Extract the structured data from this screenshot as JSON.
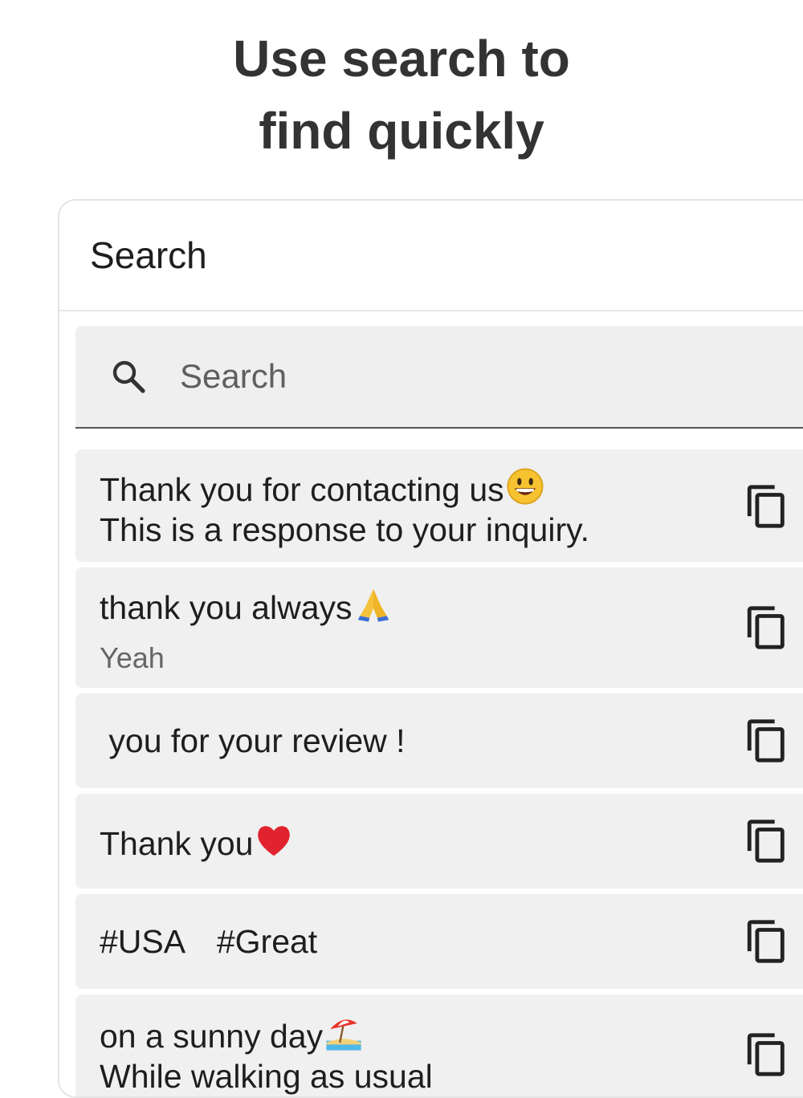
{
  "promo": {
    "line1": "Use search to",
    "line2": "find quickly"
  },
  "appbar": {
    "title": "Search"
  },
  "search": {
    "placeholder": "Search",
    "icon": "search-icon"
  },
  "items": [
    {
      "line1": "Thank you for contacting us",
      "line1_emoji": "grinning-face-emoji",
      "line2": "This is a response to your inquiry.",
      "icon": "copy-icon"
    },
    {
      "line1": "thank you always",
      "line1_emoji": "folded-hands-emoji",
      "sub": "Yeah",
      "icon": "copy-icon"
    },
    {
      "line1": " you for your review !",
      "icon": "copy-icon"
    },
    {
      "line1": "Thank you",
      "line1_emoji": "red-heart-emoji",
      "icon": "copy-icon"
    },
    {
      "line1": "#USA　#Great",
      "icon": "copy-icon"
    },
    {
      "line1": "on a sunny day",
      "line1_emoji": "beach-umbrella-emoji",
      "line2": "While walking as usual",
      "icon": "copy-icon"
    }
  ],
  "colors": {
    "title": "#333333",
    "card_bg": "#f0f0f0",
    "search_bg": "#efefef",
    "text": "#1e1e1e",
    "heart": "#e0232e"
  }
}
